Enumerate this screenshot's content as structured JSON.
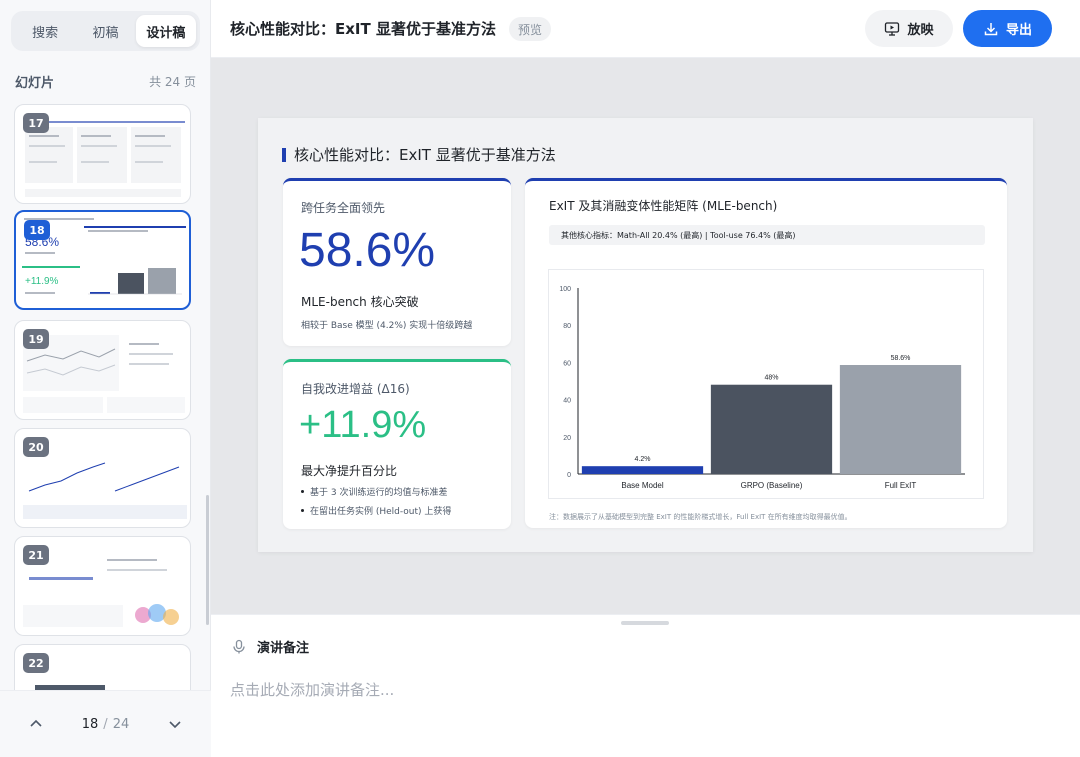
{
  "sidebar": {
    "tabs": [
      {
        "label": "搜索",
        "active": false
      },
      {
        "label": "初稿",
        "active": false
      },
      {
        "label": "设计稿",
        "active": true
      }
    ],
    "slides_title": "幻灯片",
    "slides_count": "共 24 页",
    "thumbs": [
      {
        "num": "17",
        "active": false
      },
      {
        "num": "18",
        "active": true,
        "big_value": "58.6%",
        "big_value2": "+11.9%"
      },
      {
        "num": "19",
        "active": false
      },
      {
        "num": "20",
        "active": false
      },
      {
        "num": "21",
        "active": false
      },
      {
        "num": "22",
        "active": false
      }
    ],
    "pager": {
      "current": "18",
      "separator": "/",
      "total": "24"
    }
  },
  "topbar": {
    "title": "核心性能对比：ExIT 显著优于基准方法",
    "badge": "预览",
    "play_label": "放映",
    "export_label": "导出"
  },
  "slide": {
    "title": "核心性能对比：ExIT 显著优于基准方法",
    "card1": {
      "label": "跨任务全面领先",
      "value": "58.6%",
      "sub": "MLE-bench 核心突破",
      "note": "相较于 Base 模型 (4.2%) 实现十倍级跨越"
    },
    "card2": {
      "label": "自我改进增益 (Δ16)",
      "value": "+11.9%",
      "sub": "最大净提升百分比",
      "bullets": [
        "基于 3 次训练运行的均值与标准差",
        "在留出任务实例 (Held-out) 上获得"
      ]
    },
    "card3": {
      "title": "ExIT 及其消融变体性能矩阵 (MLE-bench)",
      "strip": "其他核心指标：Math-All 20.4% (最高) | Tool-use 76.4% (最高)",
      "footnote": "注：数据展示了从基础模型到完整 ExIT 的性能阶梯式增长，Full ExIT 在所有维度均取得最优值。"
    }
  },
  "chart_data": {
    "type": "bar",
    "categories": [
      "Base Model",
      "GRPO (Baseline)",
      "Full ExIT"
    ],
    "values": [
      4.2,
      48,
      58.6
    ],
    "data_labels": [
      "4.2%",
      "48%",
      "58.6%"
    ],
    "colors": [
      "#1f3fb0",
      "#4b5360",
      "#9aa1ab"
    ],
    "ylim": [
      0,
      100
    ],
    "yticks": [
      0,
      20,
      40,
      60,
      80,
      100
    ],
    "title": "ExIT 及其消融变体性能矩阵 (MLE-bench)",
    "xlabel": "",
    "ylabel": "",
    "grid": false
  },
  "notes": {
    "title": "演讲备注",
    "placeholder": "点击此处添加演讲备注..."
  },
  "colors": {
    "primary": "#1f6ff0",
    "slide_blue": "#1f3fb0",
    "green": "#2bbf86"
  }
}
